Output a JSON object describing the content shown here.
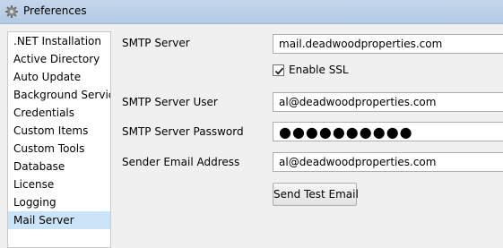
{
  "window": {
    "title": "Preferences",
    "icon": "gear-icon"
  },
  "sidebar": {
    "items": [
      {
        "label": ".NET Installation"
      },
      {
        "label": "Active Directory"
      },
      {
        "label": "Auto Update"
      },
      {
        "label": "Background Service"
      },
      {
        "label": "Credentials"
      },
      {
        "label": "Custom Items"
      },
      {
        "label": "Custom Tools"
      },
      {
        "label": "Database"
      },
      {
        "label": "License"
      },
      {
        "label": "Logging"
      },
      {
        "label": "Mail Server",
        "selected": true
      }
    ]
  },
  "form": {
    "smtp_server": {
      "label": "SMTP Server",
      "value": "mail.deadwoodproperties.com"
    },
    "enable_ssl": {
      "label": "Enable SSL",
      "checked": true
    },
    "smtp_user": {
      "label": "SMTP Server User",
      "value": "al@deadwoodproperties.com"
    },
    "smtp_password": {
      "label": "SMTP Server Password",
      "value": "●●●●●●●●●●"
    },
    "sender_email": {
      "label": "Sender Email Address",
      "value": "al@deadwoodproperties.com"
    },
    "send_test_button": "Send Test Email"
  }
}
